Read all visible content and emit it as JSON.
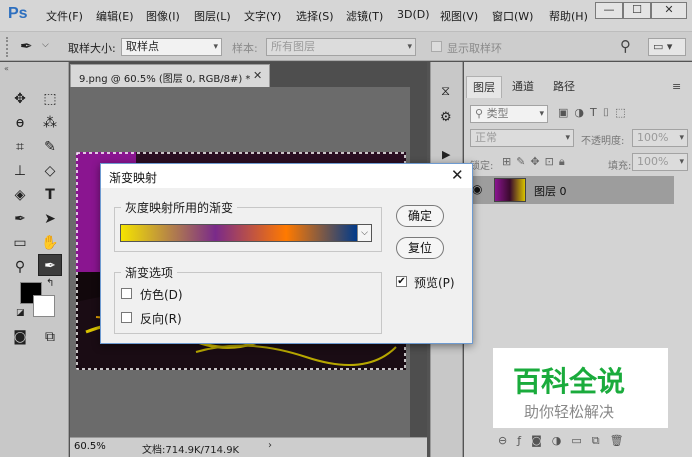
{
  "app": {
    "logo": "Ps"
  },
  "menu": [
    "文件(F)",
    "编辑(E)",
    "图像(I)",
    "图层(L)",
    "文字(Y)",
    "选择(S)",
    "滤镜(T)",
    "3D(D)",
    "视图(V)",
    "窗口(W)",
    "帮助(H)"
  ],
  "window_controls": {
    "minimize": "—",
    "maximize": "☐",
    "close": "✕"
  },
  "options": {
    "sample_size_label": "取样大小:",
    "sample_size_value": "取样点",
    "sample_label": "样本:",
    "sample_value": "所有图层",
    "show_ring_label": "显示取样环"
  },
  "document": {
    "tab_title": "9.png @ 60.5% (图层 0, RGB/8#) *",
    "zoom": "60.5%",
    "doc_info": "文档:714.9K/714.9K"
  },
  "layers_panel": {
    "tabs": [
      "图层",
      "通道",
      "路径"
    ],
    "filter_kind": "类型",
    "blend_mode": "正常",
    "opacity_label": "不透明度:",
    "opacity_value": "100%",
    "lock_label": "锁定:",
    "fill_label": "填充:",
    "fill_value": "100%",
    "layers": [
      {
        "name": "图层 0",
        "visible": true
      }
    ]
  },
  "dialog": {
    "title": "渐变映射",
    "gradient_group_label": "灰度映射所用的渐变",
    "gradient_colors": [
      "#f5e400",
      "#7a2a8a",
      "#ff7a00",
      "#003a8a"
    ],
    "options_group_label": "渐变选项",
    "dither_label": "仿色(D)",
    "dither_checked": false,
    "reverse_label": "反向(R)",
    "reverse_checked": false,
    "ok_label": "确定",
    "reset_label": "复位",
    "preview_label": "预览(P)",
    "preview_checked": true
  },
  "watermark": {
    "title": "百科全说",
    "subtitle": "助你轻松解决",
    "color": "#1aab3c"
  },
  "colors": {
    "foreground": "#000000",
    "background": "#ffffff"
  }
}
